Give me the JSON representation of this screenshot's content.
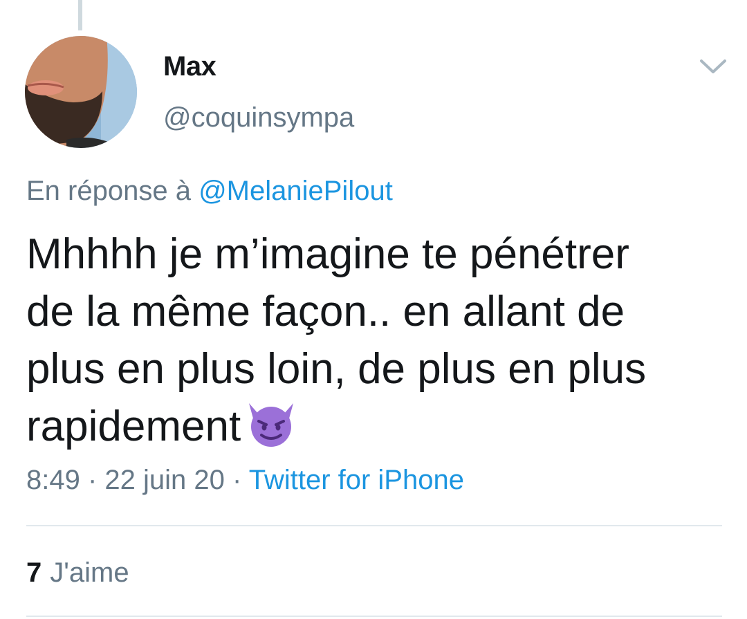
{
  "author": {
    "name": "Max",
    "handle": "@coquinsympa"
  },
  "reply": {
    "prefix": "En réponse à ",
    "mention": "@MelaniePilout"
  },
  "tweet": {
    "text_lines": [
      "Mhhhh je m’imagine te pénétrer",
      "de la même façon.. en allant de",
      "plus en plus loin, de plus en plus",
      "rapidement"
    ],
    "emoji": "smiling-imp-emoji"
  },
  "meta": {
    "time": "8:49",
    "separator": " · ",
    "date": "22 juin 20",
    "source": "Twitter for iPhone"
  },
  "likes": {
    "count": "7",
    "label": "J'aime"
  },
  "colors": {
    "text_primary": "#14171a",
    "text_secondary": "#657786",
    "link": "#1b95e0",
    "divider": "#e1e8ed",
    "emoji_purple": "#9b70d8"
  }
}
